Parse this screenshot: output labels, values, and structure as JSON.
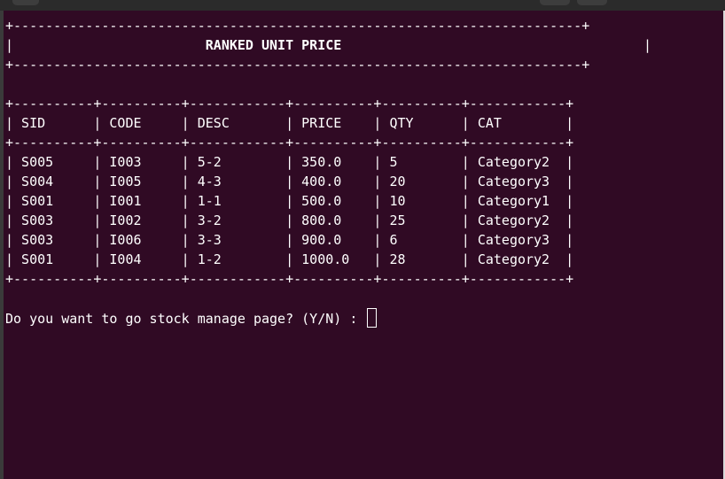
{
  "title_border": "+-----------------------------------------------------------------------+",
  "title_left_edge": "|",
  "title_text": "                        RANKED UNIT PRICE",
  "title_right_edge": "|",
  "table": {
    "border": "+----------+----------+------------+----------+----------+------------+",
    "header": "| SID      | CODE     | DESC       | PRICE    | QTY      | CAT        |",
    "columns": [
      "SID",
      "CODE",
      "DESC",
      "PRICE",
      "QTY",
      "CAT"
    ],
    "rows": [
      {
        "line": "| S005     | I003     | 5-2        | 350.0    | 5        | Category2  |",
        "sid": "S005",
        "code": "I003",
        "desc": "5-2",
        "price": "350.0",
        "qty": "5",
        "cat": "Category2"
      },
      {
        "line": "| S004     | I005     | 4-3        | 400.0    | 20       | Category3  |",
        "sid": "S004",
        "code": "I005",
        "desc": "4-3",
        "price": "400.0",
        "qty": "20",
        "cat": "Category3"
      },
      {
        "line": "| S001     | I001     | 1-1        | 500.0    | 10       | Category1  |",
        "sid": "S001",
        "code": "I001",
        "desc": "1-1",
        "price": "500.0",
        "qty": "10",
        "cat": "Category1"
      },
      {
        "line": "| S003     | I002     | 3-2        | 800.0    | 25       | Category2  |",
        "sid": "S003",
        "code": "I002",
        "desc": "3-2",
        "price": "800.0",
        "qty": "25",
        "cat": "Category2"
      },
      {
        "line": "| S003     | I006     | 3-3        | 900.0    | 6        | Category3  |",
        "sid": "S003",
        "code": "I006",
        "desc": "3-3",
        "price": "900.0",
        "qty": "6",
        "cat": "Category3"
      },
      {
        "line": "| S001     | I004     | 1-2        | 1000.0   | 28       | Category2  |",
        "sid": "S001",
        "code": "I004",
        "desc": "1-2",
        "price": "1000.0",
        "qty": "28",
        "cat": "Category2"
      }
    ]
  },
  "prompt": "Do you want to go stock manage page? (Y/N) : ",
  "colors": {
    "background": "#300a24",
    "text": "#ffffff"
  }
}
